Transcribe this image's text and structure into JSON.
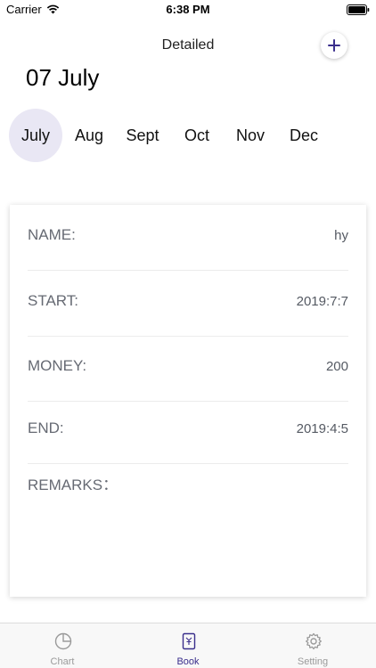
{
  "status_bar": {
    "carrier": "Carrier",
    "time": "6:38 PM"
  },
  "nav": {
    "title": "Detailed",
    "add_icon": "plus-icon"
  },
  "date_heading": "07 July",
  "months": [
    "July",
    "Aug",
    "Sept",
    "Oct",
    "Nov",
    "Dec"
  ],
  "selected_month": "July",
  "detail": {
    "name_label": "NAME:",
    "name_value": "hy",
    "start_label": "START:",
    "start_value": "2019:7:7",
    "money_label": "MONEY:",
    "money_value": "200",
    "end_label": "END:",
    "end_value": "2019:4:5",
    "remarks_label": "REMARKS："
  },
  "tabs": [
    {
      "label": "Chart",
      "icon": "pie-chart-icon"
    },
    {
      "label": "Book",
      "icon": "book-yen-icon",
      "active": true
    },
    {
      "label": "Setting",
      "icon": "gear-icon"
    }
  ],
  "colors": {
    "accent": "#3a2e8c",
    "month_highlight": "#e9e7f4",
    "label_gray": "#666a73"
  }
}
